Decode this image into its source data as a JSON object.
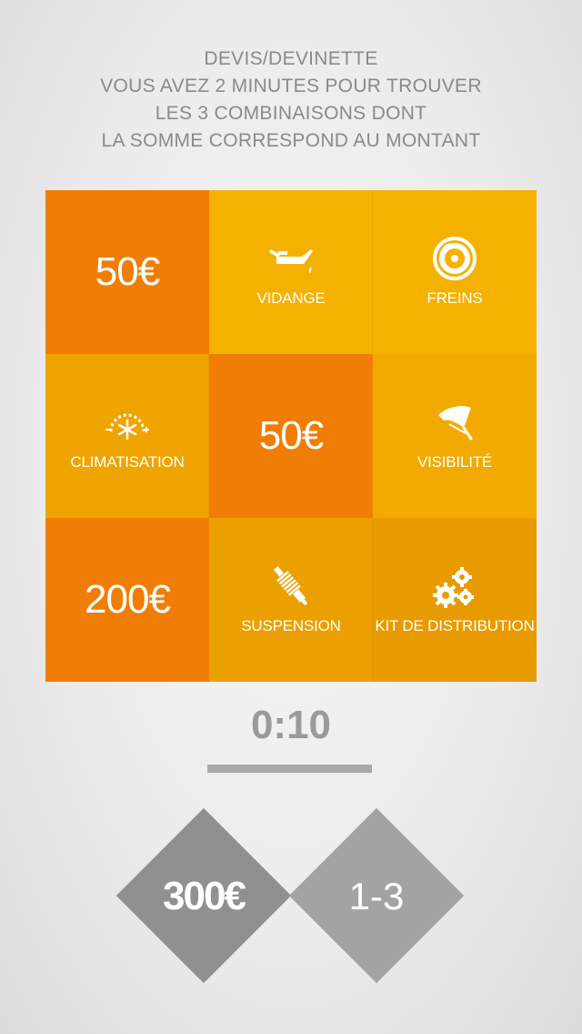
{
  "header": {
    "lines": [
      "DEVIS/DEVINETTE",
      "VOUS AVEZ 2 MINUTES POUR TROUVER",
      "LES 3 COMBINAISONS DONT",
      "LA SOMME CORRESPOND AU MONTANT"
    ]
  },
  "grid": {
    "tiles": [
      {
        "type": "price",
        "text": "50€"
      },
      {
        "type": "service",
        "label": "VIDANGE",
        "icon": "oil-can-icon"
      },
      {
        "type": "service",
        "label": "FREINS",
        "icon": "brake-disc-icon"
      },
      {
        "type": "service",
        "label": "CLIMATISATION",
        "icon": "snowflake-icon"
      },
      {
        "type": "price",
        "text": "50€"
      },
      {
        "type": "service",
        "label": "VISIBILITÉ",
        "icon": "wiper-icon"
      },
      {
        "type": "price",
        "text": "200€"
      },
      {
        "type": "service",
        "label": "SUSPENSION",
        "icon": "shock-absorber-icon"
      },
      {
        "type": "service",
        "label": "KIT DE DISTRIBUTION",
        "icon": "gears-icon"
      }
    ]
  },
  "timer": {
    "value": "0:10"
  },
  "footer": {
    "target_amount": "300€",
    "progress": "1-3"
  },
  "colors": {
    "price_tile": "#f07d05",
    "service_tile": "#f5b100",
    "accent_grey": "#909090"
  }
}
